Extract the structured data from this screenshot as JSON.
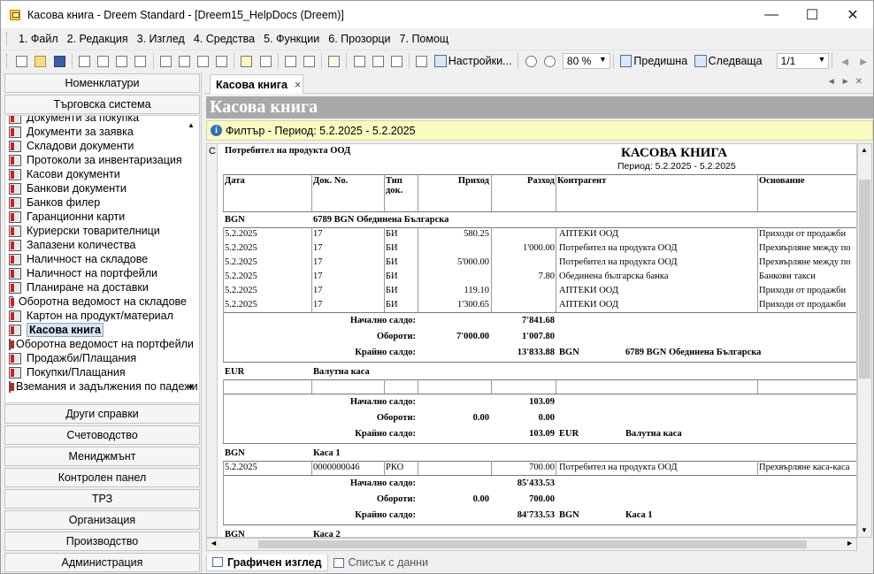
{
  "window": {
    "title": "Касова книга - Dreem Standard - [Dreem15_HelpDocs (Dreem)]",
    "minimize": "—",
    "maximize": "☐",
    "close": "✕"
  },
  "menu": [
    "1. Файл",
    "2. Редакция",
    "3. Изглед",
    "4. Средства",
    "5. Функции",
    "6. Прозорци",
    "7. Помощ"
  ],
  "toolbar": {
    "settings": "Настройки...",
    "zoom": "80 %",
    "prev": "Предишна",
    "next": "Следваща",
    "page": "1/1"
  },
  "sidebar": {
    "top_buttons": [
      "Номенклатури",
      "Търговска система"
    ],
    "items": [
      "Документи за покупка",
      "Документи за заявка",
      "Складови документи",
      "Протоколи за инвентаризация",
      "Касови документи",
      "Банкови документи",
      "Банков филер",
      "Гаранционни карти",
      "Куриерски товарителници",
      "Запазени количества",
      "Наличност на складове",
      "Наличност на портфейли",
      "Планиране на доставки",
      "Оборотна ведомост на складове",
      "Картон на продукт/материал",
      "Касова книга",
      "Оборотна ведомост на портфейли",
      "Продажби/Плащания",
      "Покупки/Плащания",
      "Вземания и задължения по падежи"
    ],
    "selected_index": 15,
    "bottom_buttons": [
      "Други справки",
      "Счетоводство",
      "Мениджмънт",
      "Контролен панел",
      "ТРЗ",
      "Организация",
      "Производство",
      "Администрация"
    ]
  },
  "tab": {
    "label": "Касова книга",
    "close": "×"
  },
  "header": {
    "title": "Касова книга"
  },
  "filter": {
    "text": "Филтър - Период: 5.2.2025 - 5.2.2025"
  },
  "report": {
    "strip": "C",
    "company": "Потребител на продукта ООД",
    "title": "КАСОВА КНИГА",
    "period": "Период: 5.2.2025 - 5.2.2025",
    "columns": {
      "date": "Дата",
      "docno": "Док. No.",
      "doctype": "Тип док.",
      "income": "Приход",
      "expense": "Разход",
      "partner": "Контрагент",
      "reason": "Основание"
    },
    "labels": {
      "opening": "Начално салдо:",
      "turnover": "Обороти:",
      "closing": "Крайно салдо:"
    },
    "groups": [
      {
        "currency": "BGN",
        "name": "6789 BGN Обединена Българска",
        "rows": [
          {
            "date": "5.2.2025",
            "docno": "17",
            "type": "БИ",
            "income": "580.25",
            "expense": "",
            "partner": "АПТЕКИ ООД",
            "reason": "Приходи от продажби"
          },
          {
            "date": "5.2.2025",
            "docno": "17",
            "type": "БИ",
            "income": "",
            "expense": "1'000.00",
            "partner": "Потребител на продукта ООД",
            "reason": "Прехвърляне между по"
          },
          {
            "date": "5.2.2025",
            "docno": "17",
            "type": "БИ",
            "income": "5'000.00",
            "expense": "",
            "partner": "Потребител на продукта ООД",
            "reason": "Прехвърляне между по"
          },
          {
            "date": "5.2.2025",
            "docno": "17",
            "type": "БИ",
            "income": "",
            "expense": "7.80",
            "partner": "Обединена българска банка",
            "reason": "Банкови такси"
          },
          {
            "date": "5.2.2025",
            "docno": "17",
            "type": "БИ",
            "income": "119.10",
            "expense": "",
            "partner": "АПТЕКИ ООД",
            "reason": "Приходи от продажби"
          },
          {
            "date": "5.2.2025",
            "docno": "17",
            "type": "БИ",
            "income": "1'300.65",
            "expense": "",
            "partner": "АПТЕКИ ООД",
            "reason": "Приходи от продажби"
          }
        ],
        "opening": "7'841.68",
        "turn_in": "7'000.00",
        "turn_out": "1'007.80",
        "closing": "13'833.88",
        "closing_cur": "BGN",
        "closing_name": "6789 BGN Обединена Българска"
      },
      {
        "currency": "EUR",
        "name": "Валутна каса",
        "rows": [],
        "opening": "103.09",
        "turn_in": "0.00",
        "turn_out": "0.00",
        "closing": "103.09",
        "closing_cur": "EUR",
        "closing_name": "Валутна каса"
      },
      {
        "currency": "BGN",
        "name": "Каса 1",
        "rows": [
          {
            "date": "5.2.2025",
            "docno": "0000000046",
            "type": "РКО",
            "income": "",
            "expense": "700.00",
            "partner": "Потребител на продукта ООД",
            "reason": "Прехвърляне каса-каса"
          }
        ],
        "opening": "85'433.53",
        "turn_in": "0.00",
        "turn_out": "700.00",
        "closing": "84'733.53",
        "closing_cur": "BGN",
        "closing_name": "Каса 1"
      },
      {
        "currency": "BGN",
        "name": "Каса 2",
        "rows": []
      }
    ]
  },
  "bottom_tabs": [
    "Графичен изглед",
    "Списък с данни"
  ]
}
